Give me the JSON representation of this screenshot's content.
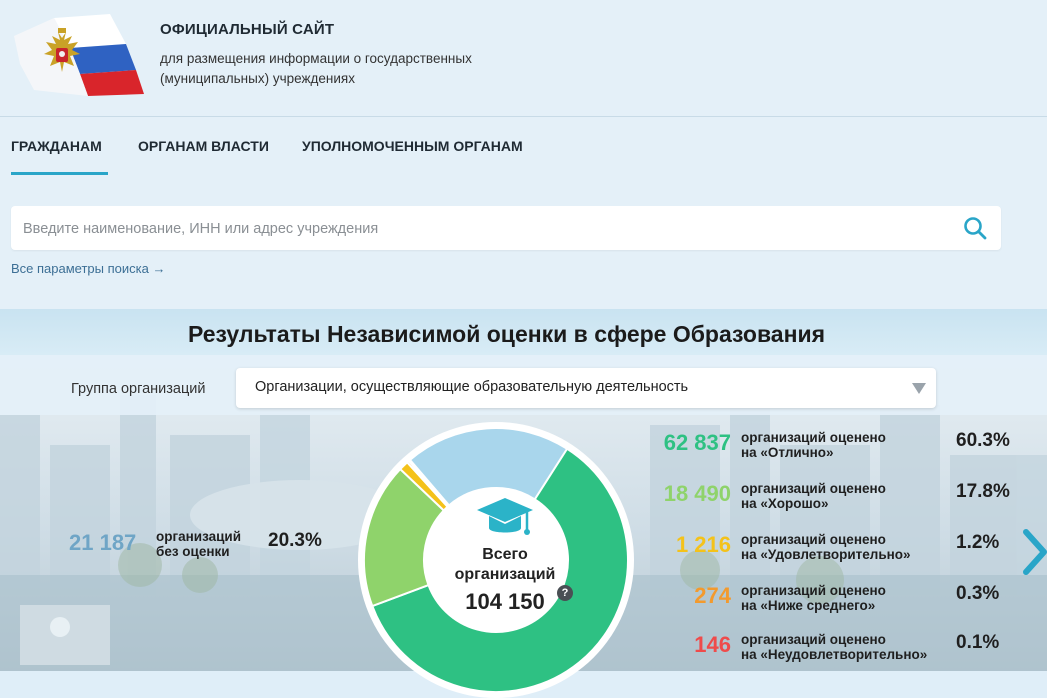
{
  "header": {
    "title": "ОФИЦИАЛЬНЫЙ САЙТ",
    "subtitle": "для размещения информации о государственных (муниципальных) учреждениях"
  },
  "nav": {
    "tabs": [
      {
        "label": "ГРАЖДАНАМ",
        "active": true
      },
      {
        "label": "ОРГАНАМ ВЛАСТИ",
        "active": false
      },
      {
        "label": "УПОЛНОМОЧЕННЫМ ОРГАНАМ",
        "active": false
      }
    ]
  },
  "search": {
    "placeholder": "Введите наименование, ИНН или адрес учреждения",
    "value": "",
    "advanced_link": "Все параметры поиска →"
  },
  "results": {
    "title": "Результаты Независимой оценки в сфере Образования",
    "group_label": "Группа организаций",
    "group_value": "Организации, осуществляющие образовательную деятельность",
    "total_label": "Всего организаций",
    "total_value": "104 150",
    "unrated": {
      "count": "21 187",
      "text": "организаций без оценки",
      "percent": "20.3%"
    },
    "ratings": [
      {
        "count": "62 837",
        "text_line1": "организаций оценено",
        "text_line2": "на «Отлично»",
        "percent": "60.3%"
      },
      {
        "count": "18 490",
        "text_line1": "организаций оценено",
        "text_line2": "на «Хорошо»",
        "percent": "17.8%"
      },
      {
        "count": "1 216",
        "text_line1": "организаций оценено",
        "text_line2": "на «Удовлетворительно»",
        "percent": "1.2%"
      },
      {
        "count": "274",
        "text_line1": "организаций оценено",
        "text_line2": "на «Ниже среднего»",
        "percent": "0.3%"
      },
      {
        "count": "146",
        "text_line1": "организаций оценено",
        "text_line2": "на «Неудовлетворительно»",
        "percent": "0.1%"
      }
    ]
  },
  "colors": {
    "accent": "#29a5c8",
    "excellent": "#2ec183",
    "good": "#8fd36b",
    "satisfactory": "#f4c21a",
    "below_average": "#f39a2d",
    "unsatisfactory": "#ef4b4b",
    "unrated": "#a9d6ec"
  },
  "icons": {
    "search": "search-icon",
    "emblem": "coat-of-arms-icon",
    "graduation": "graduation-cap-icon",
    "help": "question-icon",
    "next": "chevron-right-icon"
  },
  "chart_data": {
    "type": "pie",
    "categories": [
      "Отлично",
      "Хорошо",
      "Удовлетворительно",
      "Ниже среднего",
      "Неудовлетворительно",
      "без оценки"
    ],
    "values": [
      62837,
      18490,
      1216,
      274,
      146,
      21187
    ],
    "percent": [
      60.3,
      17.8,
      1.2,
      0.3,
      0.1,
      20.3
    ],
    "colors": [
      "#2ec183",
      "#8fd36b",
      "#f4c21a",
      "#f39a2d",
      "#ef4b4b",
      "#a9d6ec"
    ]
  }
}
